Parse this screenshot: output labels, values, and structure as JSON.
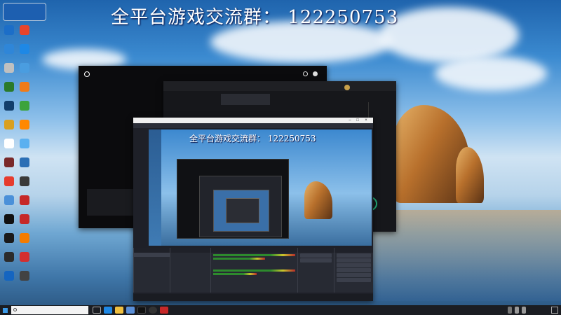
{
  "banner": {
    "text": "全平台游戏交流群： 122250753"
  },
  "overlay_text": "全平台游戏交流群： 122250753",
  "desktop_icons": [
    {
      "label": "",
      "color": "#1c6ec8"
    },
    {
      "label": "",
      "color": "#e8442b"
    },
    {
      "label": "",
      "color": "#2f86d8"
    },
    {
      "label": "",
      "color": "#1e88e5"
    },
    {
      "label": "",
      "color": "#c0c0c0"
    },
    {
      "label": "",
      "color": "#4a9de0"
    },
    {
      "label": "",
      "color": "#2a7a2a"
    },
    {
      "label": "",
      "color": "#f07b19"
    },
    {
      "label": "",
      "color": "#123e6b"
    },
    {
      "label": "",
      "color": "#3ca33c"
    },
    {
      "label": "",
      "color": "#d9a020"
    },
    {
      "label": "",
      "color": "#ff8800"
    },
    {
      "label": "",
      "color": "#ffffff"
    },
    {
      "label": "",
      "color": "#5ab0f0"
    },
    {
      "label": "",
      "color": "#7a2a2a"
    },
    {
      "label": "",
      "color": "#2b6fb5"
    },
    {
      "label": "",
      "color": "#e63c2e"
    },
    {
      "label": "",
      "color": "#3a3a3a"
    },
    {
      "label": "",
      "color": "#4a90d9"
    },
    {
      "label": "",
      "color": "#c62828"
    },
    {
      "label": "",
      "color": "#111111"
    },
    {
      "label": "",
      "color": "#c62828"
    },
    {
      "label": "",
      "color": "#1a1a1a"
    },
    {
      "label": "",
      "color": "#f57c00"
    },
    {
      "label": "",
      "color": "#2b2b2b"
    },
    {
      "label": "",
      "color": "#d32f2f"
    },
    {
      "label": "",
      "color": "#1565c0"
    },
    {
      "label": "",
      "color": "#424242"
    }
  ],
  "logitech": {
    "title": "",
    "ok_label": ""
  },
  "aux_window": {
    "title": ""
  },
  "obs": {
    "title": "",
    "menu": [
      "",
      "",
      "",
      "",
      "",
      "",
      "",
      "",
      ""
    ],
    "scenes_header": "",
    "sources_header": "",
    "mixer_header": "",
    "transitions_header": "",
    "controls_header": "",
    "controls": [
      "",
      "",
      "",
      "",
      "",
      ""
    ],
    "status": ""
  },
  "taskbar": {
    "search_placeholder": "",
    "clock_time": "",
    "clock_date": ""
  }
}
